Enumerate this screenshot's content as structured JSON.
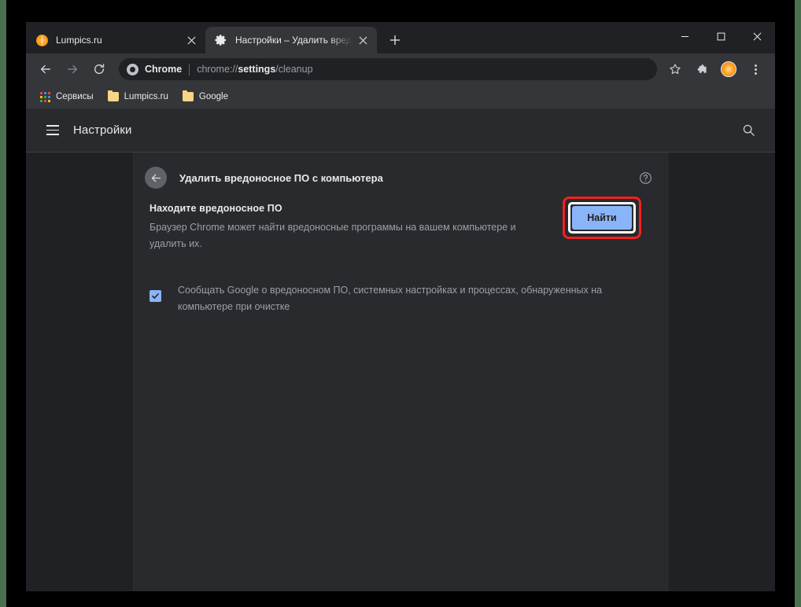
{
  "window": {
    "controls": {
      "minimize": "minimize-icon",
      "maximize": "maximize-icon",
      "close": "close-icon"
    }
  },
  "tabs": [
    {
      "title": "Lumpics.ru",
      "favicon": "orange-slice-icon",
      "active": false
    },
    {
      "title": "Настройки – Удалить вредоносное ПО с компьютера",
      "favicon": "gear-icon",
      "active": true
    }
  ],
  "newtab_label": "+",
  "toolbar": {
    "back": "back-arrow-icon",
    "forward": "forward-arrow-icon",
    "reload": "reload-icon",
    "omnibox": {
      "chip_label": "Chrome",
      "url_prefix": "chrome://",
      "url_bold": "settings",
      "url_suffix": "/cleanup",
      "full_url": "chrome://settings/cleanup"
    },
    "bookmark_star": "star-icon",
    "extensions": "puzzle-piece-icon",
    "profile": "profile-avatar",
    "menu": "kebab-menu-icon"
  },
  "bookmarks": [
    {
      "label": "Сервисы",
      "icon": "apps-grid-icon"
    },
    {
      "label": "Lumpics.ru",
      "icon": "folder-icon"
    },
    {
      "label": "Google",
      "icon": "folder-icon"
    }
  ],
  "settings": {
    "hamburger": "hamburger-menu-icon",
    "title": "Настройки",
    "search_icon": "search-icon"
  },
  "card": {
    "back_icon": "back-arrow-icon",
    "title": "Удалить вредоносное ПО с компьютера",
    "help_icon": "help-circle-icon",
    "section": {
      "heading": "Находите вредоносное ПО",
      "description": "Браузер Chrome может найти вредоносные программы на вашем компьютере и удалить их.",
      "button_label": "Найти"
    },
    "checkbox": {
      "checked": true,
      "label": "Сообщать Google о вредоносном ПО, системных настройках и процессах, обнаруженных на компьютере при очистке"
    }
  },
  "colors": {
    "accent": "#8ab4f8",
    "highlight_ring": "#f32020",
    "highlight_inner_ring": "#ffffff",
    "page_bg": "#202124",
    "card_bg": "#292a2d",
    "toolbar_bg": "#35363a",
    "text_primary": "#e8eaed",
    "text_secondary": "#9aa0a6"
  }
}
